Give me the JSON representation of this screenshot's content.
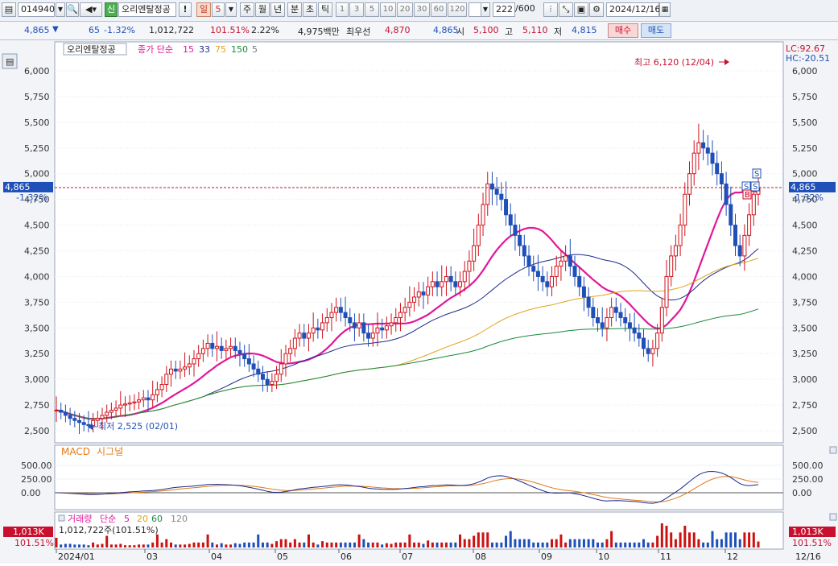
{
  "toolbar": {
    "code": "014940",
    "badge": "신",
    "stock_name": "오리엔탈정공",
    "alert": "!",
    "period_day": "일",
    "period_num": "5",
    "week": "주",
    "month": "월",
    "year": "년",
    "minute": "분",
    "second": "초",
    "tick": "틱",
    "nums": [
      "1",
      "3",
      "5",
      "10",
      "20",
      "30",
      "60",
      "120"
    ],
    "count": "222",
    "count_total": "/600",
    "date": "2024/12/16"
  },
  "quote": {
    "price": "4,865",
    "down_arrow": "▼",
    "change": "65",
    "change_pct": "-1.32%",
    "volume": "1,012,722",
    "vol_ratio": "101.51%",
    "turnover": "2.22%",
    "amount": "4,975백만",
    "best_label": "최우선",
    "best_ask": "4,870",
    "best_bid": "4,865",
    "open_label": "시",
    "open": "5,100",
    "high_label": "고",
    "high": "5,110",
    "low_label": "저",
    "low": "4,815",
    "buy": "매수",
    "sell": "매도"
  },
  "chart": {
    "legend_name": "오리엔탈정공",
    "legend_ma": "종가 단순",
    "ma_periods": [
      "15",
      "33",
      "75",
      "150",
      "5"
    ],
    "lc": "LC:92.67",
    "hc": "HC:-20.51",
    "high_note": "최고 6,120 (12/04)",
    "low_note": "최저 2,525 (02/01)",
    "current_price": "4,865",
    "current_pct": "-1.32%",
    "macd_label": "MACD",
    "signal_label": "시그널",
    "vol_label": "거래량",
    "vol_ma_label": "단순",
    "vol_ma": [
      "5",
      "20",
      "60",
      "120"
    ],
    "vol_info": "1,012,722주(101.51%)",
    "vol_badge": "1,013K",
    "vol_badge_pct": "101.51%",
    "last_date": "12/16",
    "marker_s": "S",
    "marker_b": "B"
  },
  "chart_data": {
    "type": "candlestick",
    "title": "",
    "y_ticks": [
      "6,000",
      "5,750",
      "5,500",
      "5,250",
      "5,000",
      "4,750",
      "4,500",
      "4,250",
      "4,000",
      "3,750",
      "3,500",
      "3,250",
      "3,000",
      "2,750",
      "2,500"
    ],
    "ylim": [
      2450,
      6250
    ],
    "x_ticks": [
      "2024/01",
      "03",
      "04",
      "05",
      "06",
      "07",
      "08",
      "09",
      "10",
      "11",
      "12"
    ],
    "macd_ticks": [
      "500.00",
      "250.00",
      "0.00"
    ],
    "close": [
      2700,
      2680,
      2650,
      2620,
      2600,
      2580,
      2560,
      2550,
      2600,
      2620,
      2650,
      2680,
      2700,
      2720,
      2750,
      2760,
      2770,
      2780,
      2800,
      2820,
      2800,
      2850,
      2900,
      2950,
      3050,
      3100,
      3080,
      3100,
      3120,
      3150,
      3200,
      3250,
      3300,
      3350,
      3300,
      3320,
      3280,
      3300,
      3320,
      3280,
      3250,
      3200,
      3150,
      3100,
      3050,
      3000,
      2950,
      2980,
      3050,
      3150,
      3250,
      3300,
      3400,
      3450,
      3400,
      3450,
      3500,
      3480,
      3550,
      3600,
      3650,
      3700,
      3650,
      3600,
      3550,
      3500,
      3550,
      3450,
      3400,
      3450,
      3500,
      3480,
      3520,
      3550,
      3600,
      3650,
      3700,
      3750,
      3800,
      3850,
      3820,
      3900,
      3950,
      3900,
      3950,
      4000,
      3950,
      3900,
      3950,
      4050,
      4150,
      4300,
      4500,
      4700,
      4900,
      4850,
      4800,
      4750,
      4600,
      4500,
      4400,
      4300,
      4200,
      4100,
      4050,
      4000,
      3950,
      3900,
      4000,
      4100,
      4150,
      4200,
      4100,
      4000,
      3900,
      3800,
      3700,
      3600,
      3550,
      3500,
      3600,
      3700,
      3650,
      3600,
      3550,
      3500,
      3450,
      3400,
      3300,
      3250,
      3300,
      3450,
      3700,
      4000,
      4200,
      4300,
      4500,
      4800,
      5000,
      5200,
      5300,
      5250,
      5200,
      5100,
      5000,
      4900,
      4700,
      4500,
      4300,
      4200,
      4400,
      4600,
      4800,
      4865
    ],
    "ma_colors": {
      "ma15": "#e0189a",
      "ma33": "#1c2a8a",
      "ma75": "#e0a21a",
      "ma150": "#1a8a3a",
      "ma5": "#777777"
    },
    "macd_color": "#1c2a8a",
    "signal_color": "#e07a1a",
    "volume_color": "#cc1111"
  }
}
